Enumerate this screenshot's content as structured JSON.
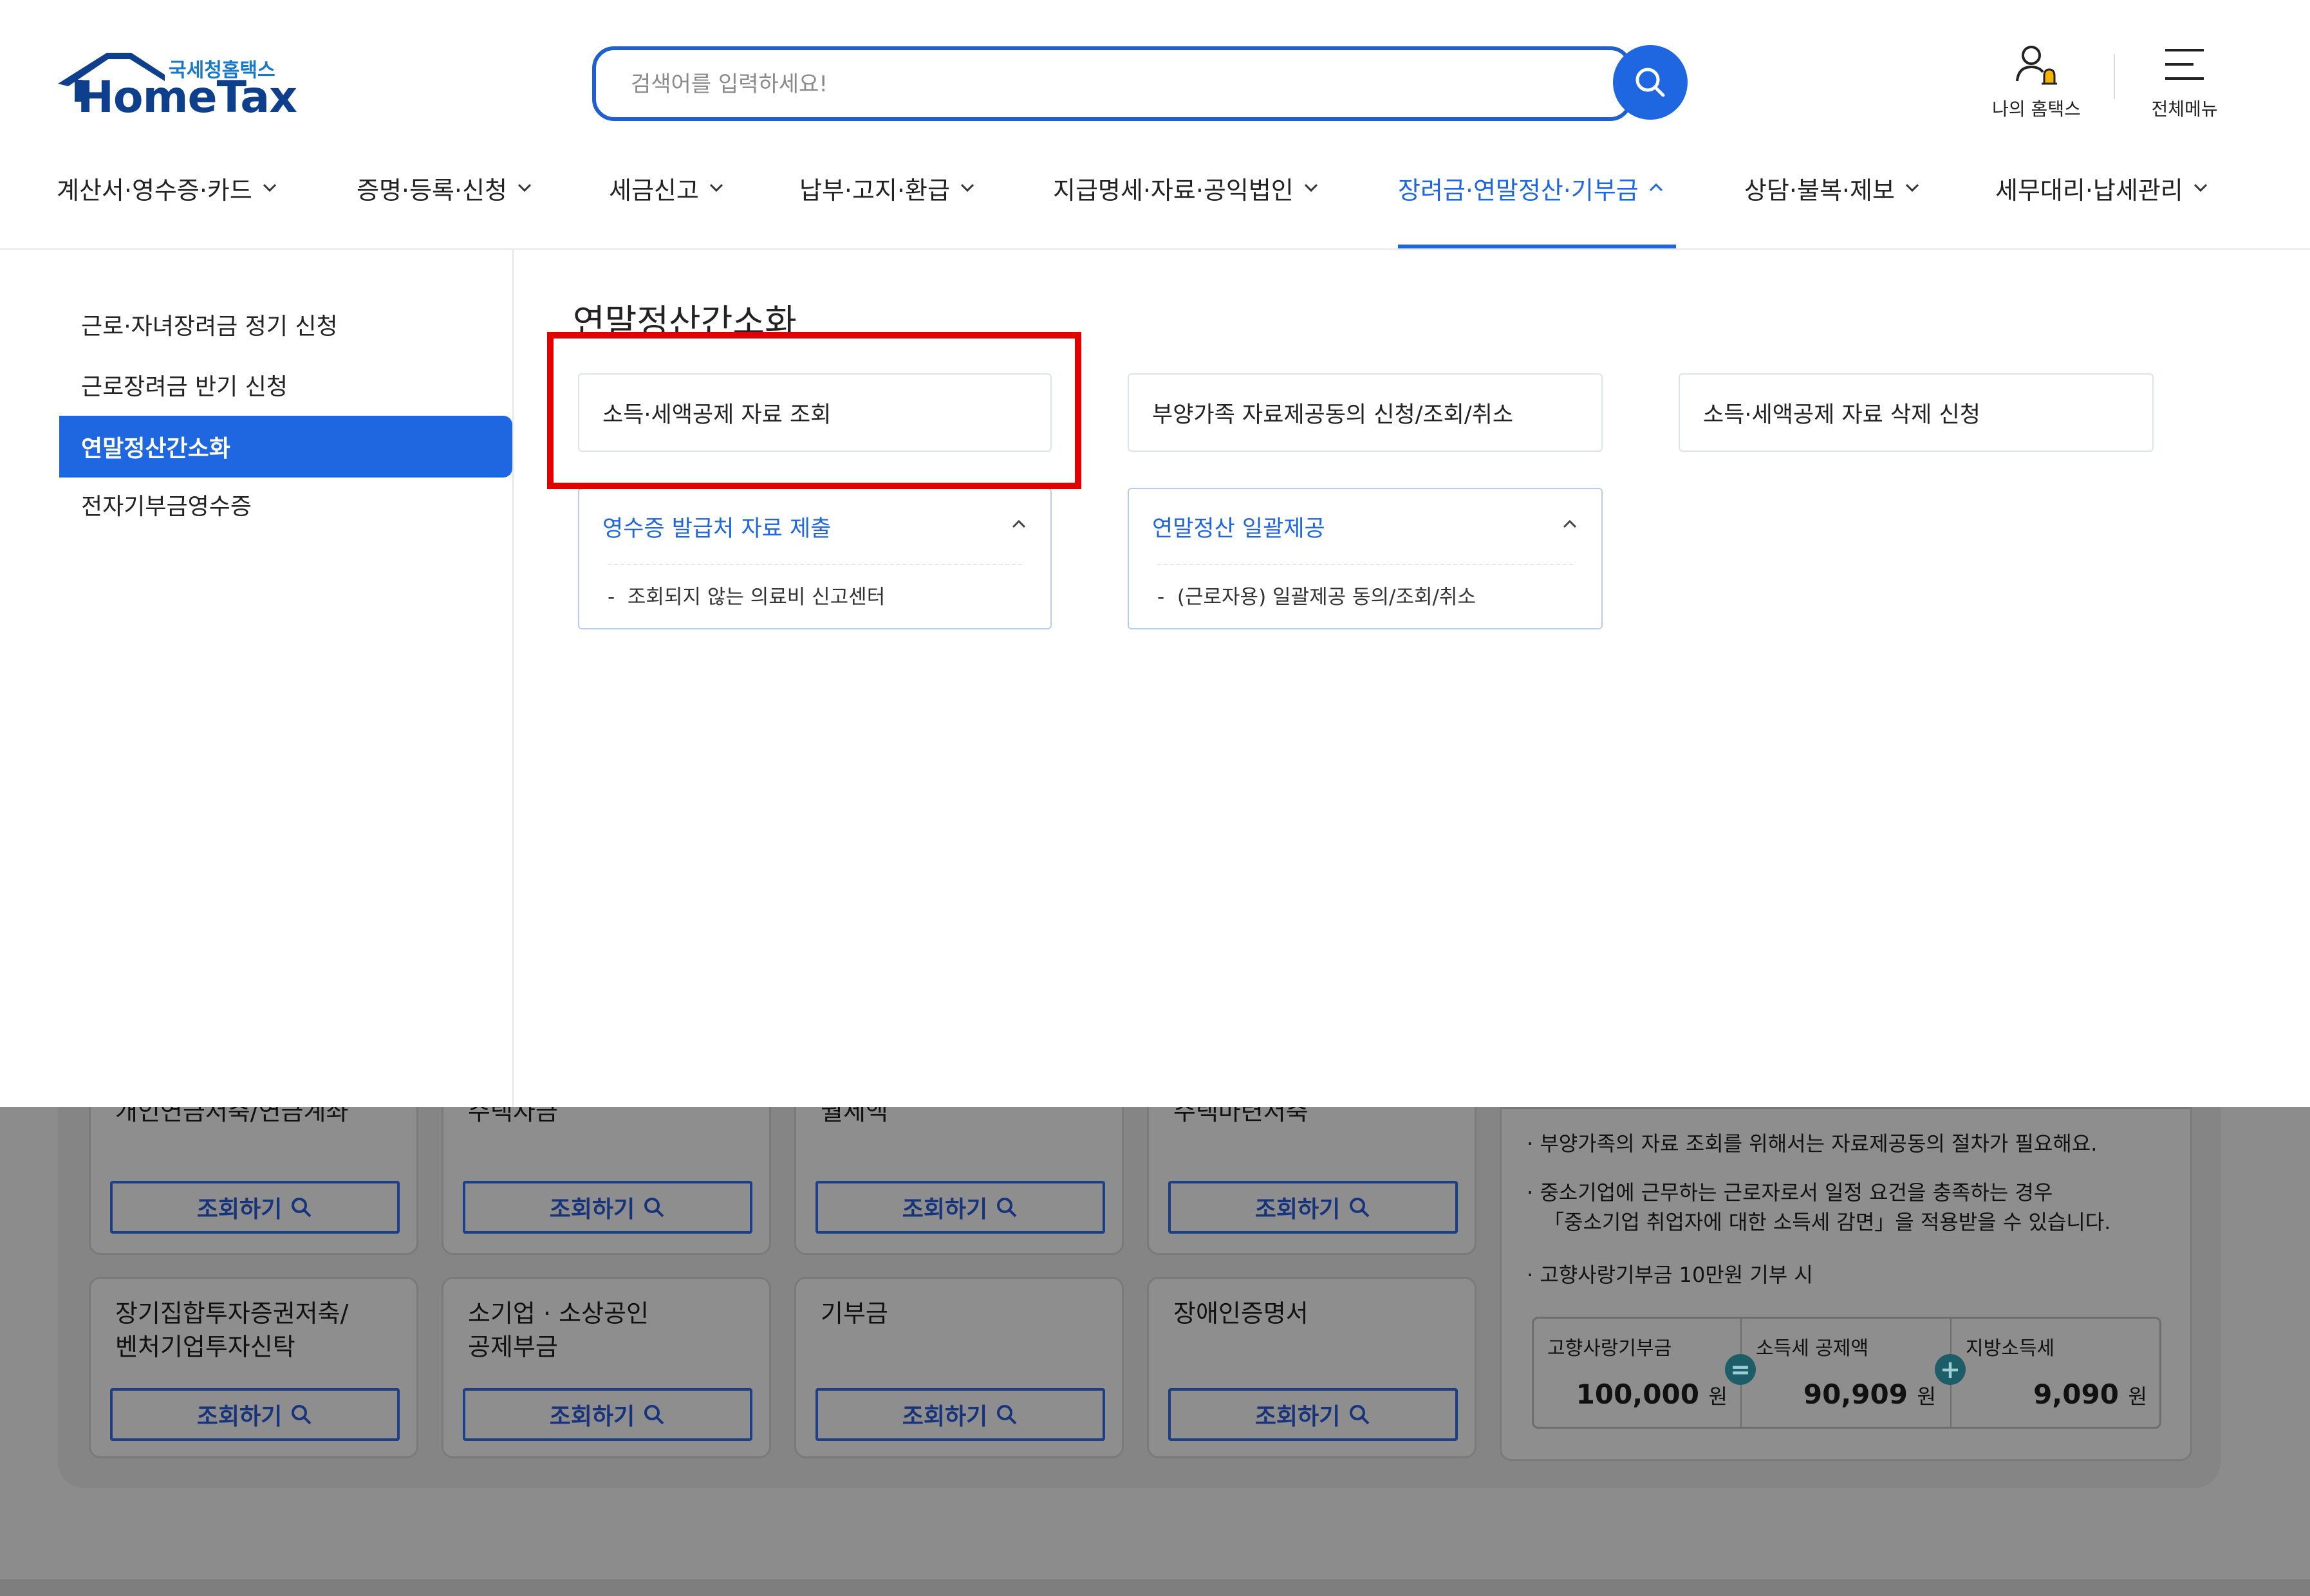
{
  "header": {
    "logo_kr": "국세청홈택스",
    "logo_en": "HomeTax",
    "search_placeholder": "검색어를 입력하세요!",
    "my_hometax": "나의 홈택스",
    "all_menu": "전체메뉴"
  },
  "nav": [
    {
      "label": "계산서·영수증·카드"
    },
    {
      "label": "증명·등록·신청"
    },
    {
      "label": "세금신고"
    },
    {
      "label": "납부·고지·환급"
    },
    {
      "label": "지급명세·자료·공익법인"
    },
    {
      "label": "장려금·연말정산·기부금",
      "active": true
    },
    {
      "label": "상담·불복·제보"
    },
    {
      "label": "세무대리·납세관리"
    }
  ],
  "sidebar": {
    "items": [
      {
        "label": "근로·자녀장려금 정기 신청"
      },
      {
        "label": "근로장려금 반기 신청"
      },
      {
        "label": "연말정산간소화",
        "active": true
      },
      {
        "label": "전자기부금영수증"
      }
    ]
  },
  "panel": {
    "title": "연말정산간소화",
    "cards": [
      {
        "label": "소득·세액공제 자료 조회"
      },
      {
        "label": "부양가족 자료제공동의 신청/조회/취소"
      },
      {
        "label": "소득·세액공제 자료 삭제 신청"
      }
    ],
    "expanded": [
      {
        "label": "영수증 발급처 자료 제출",
        "sub": "조회되지 않는 의료비 신고센터"
      },
      {
        "label": "연말정산 일괄제공",
        "sub": "(근로자용) 일괄제공 동의/조회/취소"
      }
    ]
  },
  "background": {
    "row1_titles": [
      "개인연금저축/연금계좌",
      "주택자금",
      "월세액",
      "주택마련저축"
    ],
    "row2_titles": [
      "장기집합투자증권저축/\n벤처기업투자신탁",
      "소기업 · 소상공인\n공제부금",
      "기부금",
      "장애인증명서"
    ],
    "query_button": "조회하기",
    "info": [
      "부양가족의 자료 조회를 위해서는 자료제공동의 절차가 필요해요.",
      "중소기업에 근무하는 근로자로서 일정 요건을 충족하는 경우",
      "「중소기업 취업자에 대한 소득세 감면」을 적용받을 수 있습니다.",
      "고향사랑기부금 10만원 기부 시"
    ],
    "calc": [
      {
        "label": "고향사랑기부금",
        "value": "100,000",
        "unit": "원"
      },
      {
        "label": "소득세 공제액",
        "value": "90,909",
        "unit": "원"
      },
      {
        "label": "지방소득세",
        "value": "9,090",
        "unit": "원"
      }
    ],
    "ops": [
      "=",
      "+"
    ]
  }
}
